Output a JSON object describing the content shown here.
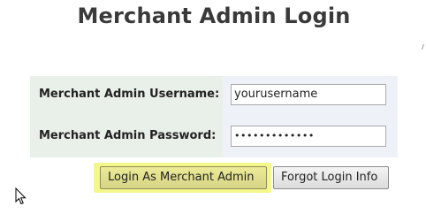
{
  "page": {
    "title": "Merchant Admin Login"
  },
  "form": {
    "username_label": "Merchant Admin Username:",
    "username_value": "yourusername",
    "password_label": "Merchant Admin Password:",
    "password_value": "•••••••••••••"
  },
  "buttons": {
    "login_label": "Login As Merchant Admin",
    "forgot_label": "Forgot Login Info"
  },
  "colors": {
    "highlight": "#f4f78a",
    "label_bg": "#e9efe9",
    "input_bg": "#eef2f8"
  },
  "icons": {
    "cursor": "mouse-pointer-icon"
  }
}
